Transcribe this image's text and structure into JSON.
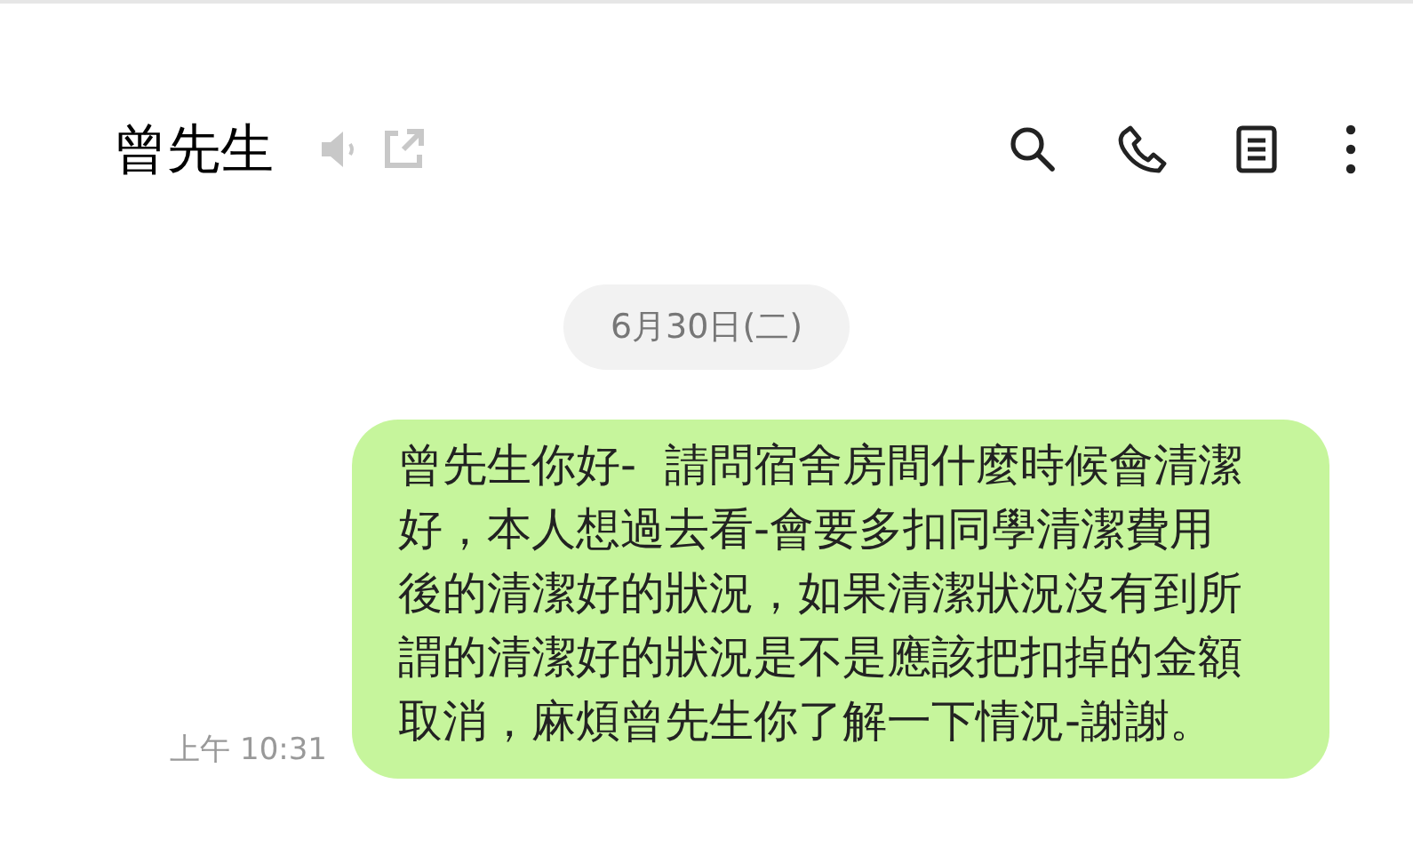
{
  "header": {
    "title": "曾先生"
  },
  "date_separator": "6月30日(二)",
  "messages": [
    {
      "time": "上午 10:31",
      "text": "曾先生你好-  請問宿舍房間什麼時候會清潔好，本人想過去看-會要多扣同學清潔費用後的清潔好的狀況，如果清潔狀況沒有到所謂的清潔好的狀況是不是應該把扣掉的金額取消，麻煩曾先生你了解一下情況-謝謝。"
    }
  ]
}
